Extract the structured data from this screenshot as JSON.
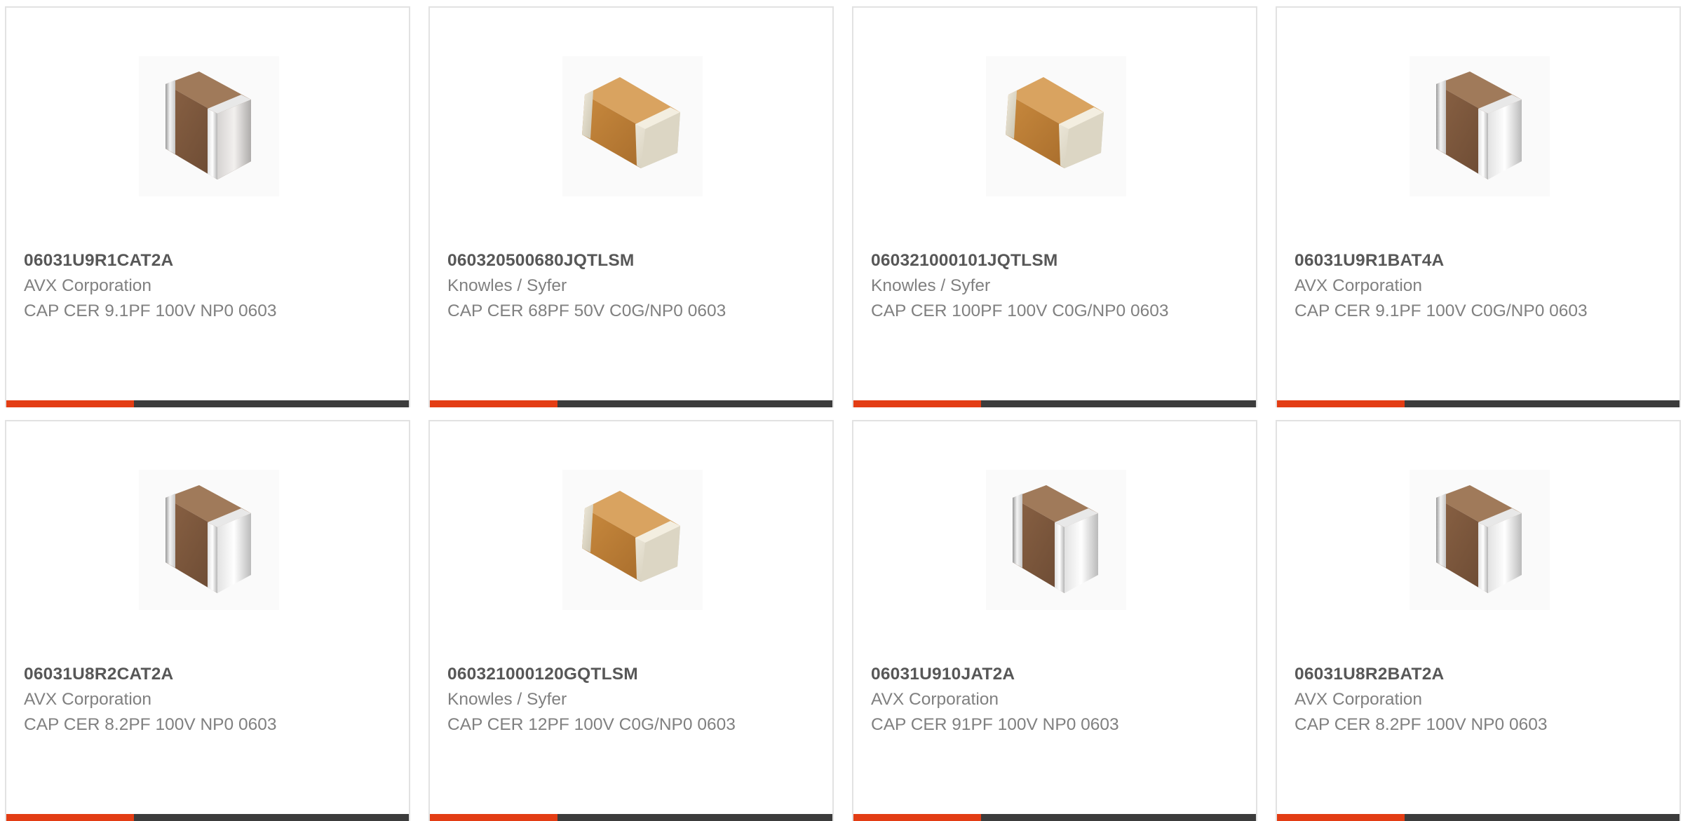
{
  "colors": {
    "accent": "#e33d14",
    "bar": "#3c3c3c",
    "part_number": "#575757",
    "secondary_text": "#808080",
    "card_border": "#e2e2e2"
  },
  "products": [
    {
      "part_number": "06031U9R1CAT2A",
      "manufacturer": "AVX Corporation",
      "description": "CAP CER 9.1PF 100V NP0 0603",
      "image_icon": "capacitor-brown-icon"
    },
    {
      "part_number": "060320500680JQTLSM",
      "manufacturer": "Knowles / Syfer",
      "description": "CAP CER 68PF 50V C0G/NP0 0603",
      "image_icon": "capacitor-tan-icon"
    },
    {
      "part_number": "060321000101JQTLSM",
      "manufacturer": "Knowles / Syfer",
      "description": "CAP CER 100PF 100V C0G/NP0 0603",
      "image_icon": "capacitor-tan-icon"
    },
    {
      "part_number": "06031U9R1BAT4A",
      "manufacturer": "AVX Corporation",
      "description": "CAP CER 9.1PF 100V C0G/NP0 0603",
      "image_icon": "capacitor-brown-icon"
    },
    {
      "part_number": "06031U8R2CAT2A",
      "manufacturer": "AVX Corporation",
      "description": "CAP CER 8.2PF 100V NP0 0603",
      "image_icon": "capacitor-brown-icon"
    },
    {
      "part_number": "060321000120GQTLSM",
      "manufacturer": "Knowles / Syfer",
      "description": "CAP CER 12PF 100V C0G/NP0 0603",
      "image_icon": "capacitor-tan-icon"
    },
    {
      "part_number": "06031U910JAT2A",
      "manufacturer": "AVX Corporation",
      "description": "CAP CER 91PF 100V NP0 0603",
      "image_icon": "capacitor-brown-icon"
    },
    {
      "part_number": "06031U8R2BAT2A",
      "manufacturer": "AVX Corporation",
      "description": "CAP CER 8.2PF 100V NP0 0603",
      "image_icon": "capacitor-brown-icon"
    }
  ]
}
